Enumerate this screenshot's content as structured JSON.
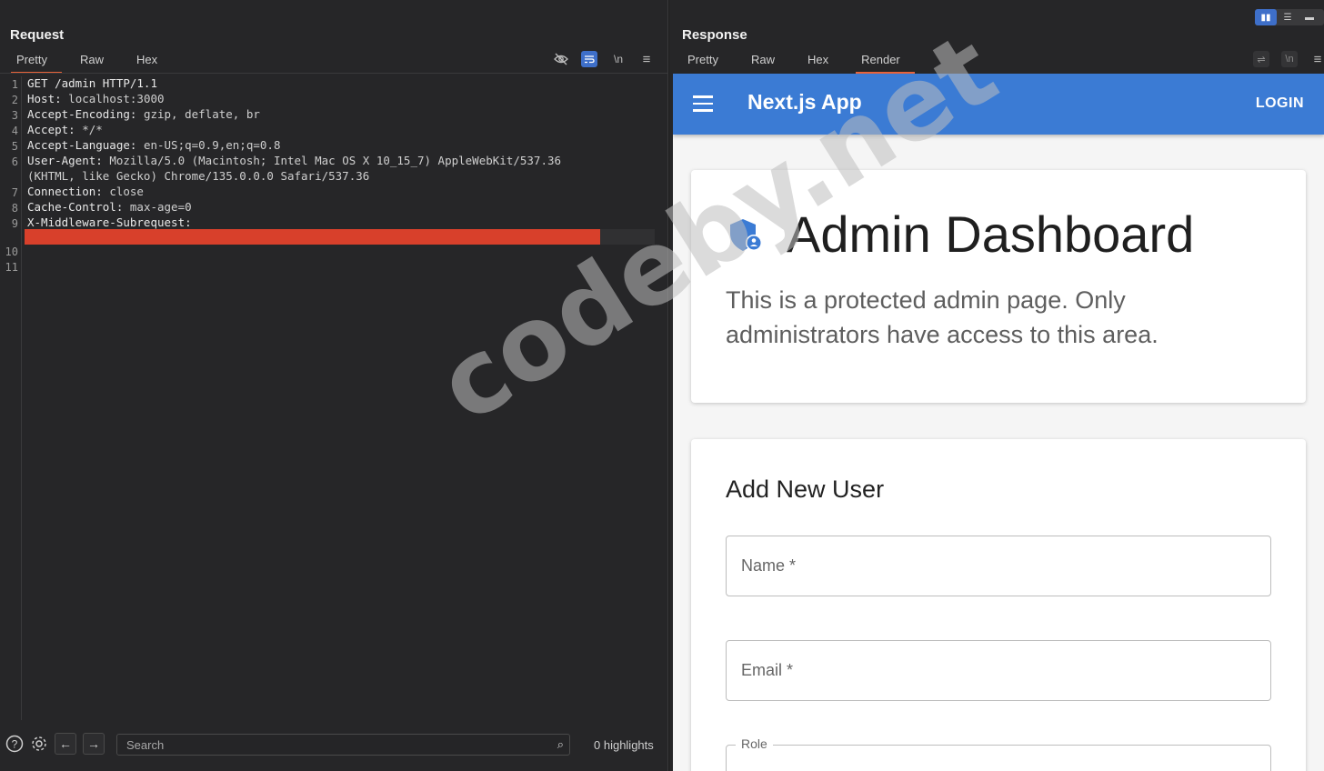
{
  "request": {
    "title": "Request",
    "tabs": [
      {
        "label": "Pretty",
        "active": true
      },
      {
        "label": "Raw",
        "active": false
      },
      {
        "label": "Hex",
        "active": false
      }
    ],
    "toolbar": {
      "hide_icon": "eye-slash-icon",
      "wrap_icon": "wrap-icon",
      "newline_label": "\\n",
      "menu_icon": "menu-icon"
    },
    "lines": [
      {
        "num": "1",
        "name": "GET /admin HTTP/1.1",
        "value": ""
      },
      {
        "num": "2",
        "name": "Host:",
        "value": "localhost:3000"
      },
      {
        "num": "3",
        "name": "Accept-Encoding:",
        "value": "gzip, deflate, br"
      },
      {
        "num": "4",
        "name": "Accept:",
        "value": "*/*"
      },
      {
        "num": "5",
        "name": "Accept-Language:",
        "value": "en-US;q=0.9,en;q=0.8"
      },
      {
        "num": "6",
        "name": "User-Agent:",
        "value": "Mozilla/5.0 (Macintosh; Intel Mac OS X 10_15_7) AppleWebKit/537.36"
      },
      {
        "num": "",
        "name": "(KHTML, like Gecko) Chrome/135.0.0.0 Safari/537.36",
        "value": ""
      },
      {
        "num": "7",
        "name": "Connection:",
        "value": "close"
      },
      {
        "num": "8",
        "name": "Cache-Control:",
        "value": "max-age=0"
      },
      {
        "num": "9",
        "name": "X-Middleware-Subrequest:",
        "value": ""
      },
      {
        "num": "",
        "name": "",
        "value": ""
      },
      {
        "num": "10",
        "name": "",
        "value": ""
      },
      {
        "num": "11",
        "name": "",
        "value": ""
      }
    ],
    "bottom": {
      "search_placeholder": "Search",
      "highlights": "0 highlights"
    },
    "highlight_color": "#d8402b"
  },
  "response": {
    "title": "Response",
    "tabs": [
      {
        "label": "Pretty",
        "active": false
      },
      {
        "label": "Raw",
        "active": false
      },
      {
        "label": "Hex",
        "active": false
      },
      {
        "label": "Render",
        "active": true
      }
    ],
    "render": {
      "app_title": "Next.js App",
      "login": "LOGIN",
      "dashboard_title": "Admin Dashboard",
      "dashboard_desc": "This is a protected admin page. Only administrators have access to this area.",
      "form_title": "Add New User",
      "name_label": "Name *",
      "email_label": "Email *",
      "role_label": "Role",
      "accent": "#3b7bd4"
    }
  },
  "watermark": "codeby.net",
  "colors": {
    "tab_accent": "#e8633a",
    "toggle_active": "#3e6fc9"
  }
}
